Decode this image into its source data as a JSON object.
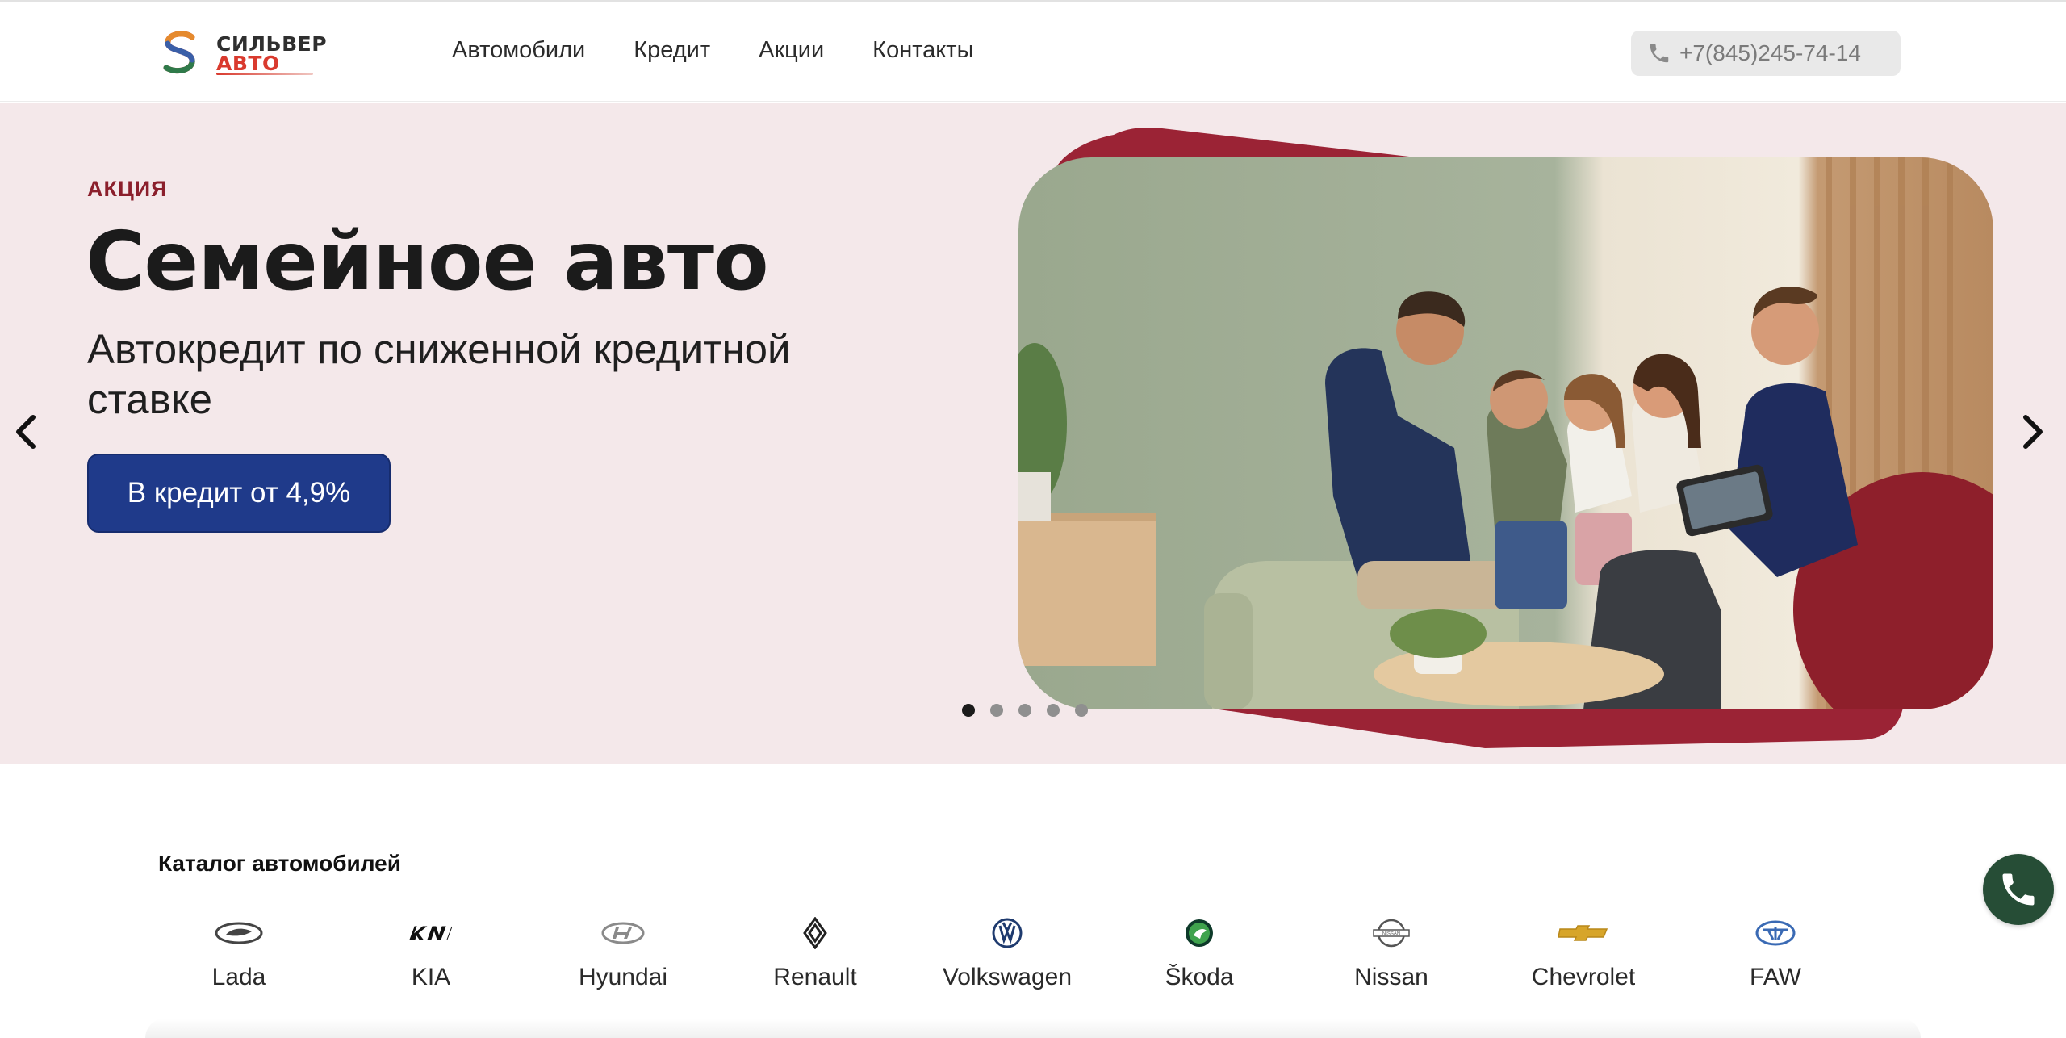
{
  "header": {
    "logo_line1": "СИЛЬВЕР",
    "logo_line2": "АВТО",
    "nav": [
      "Автомобили",
      "Кредит",
      "Акции",
      "Контакты"
    ],
    "phone": "+7(845)245-74-14",
    "phone_icon": "phone-icon"
  },
  "hero": {
    "tag": "АКЦИЯ",
    "title": "Семейное авто",
    "subtitle": "Автокредит по сниженной кредитной ставке",
    "cta": "В кредит от 4,9%",
    "slides_total": 5,
    "active_slide": 1,
    "colors": {
      "background": "#f4e8ea",
      "accent": "#9b2335",
      "button": "#1f3a8a"
    }
  },
  "catalog": {
    "title": "Каталог автомобилей",
    "brands": [
      "Lada",
      "KIA",
      "Hyundai",
      "Renault",
      "Volkswagen",
      "Škoda",
      "Nissan",
      "Chevrolet",
      "FAW"
    ]
  },
  "floating": {
    "call_icon": "phone-icon"
  }
}
